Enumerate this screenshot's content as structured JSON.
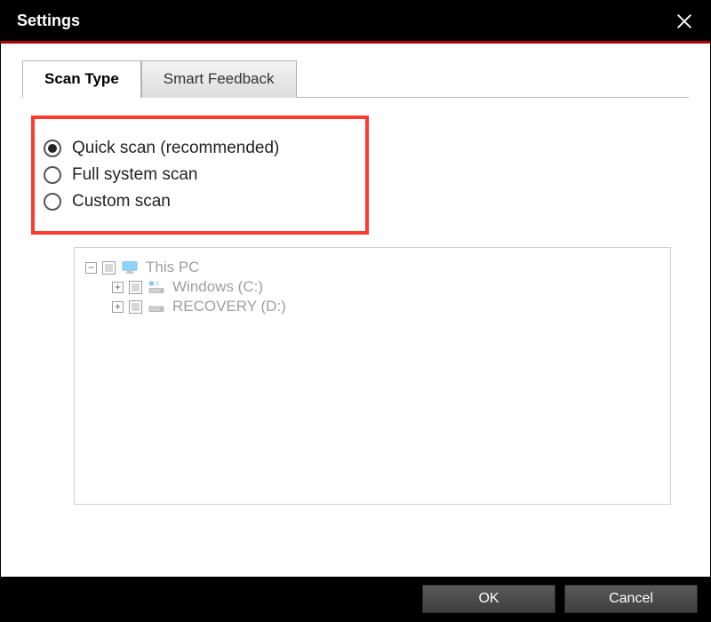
{
  "title": "Settings",
  "tabs": {
    "scan_type": "Scan Type",
    "smart_feedback": "Smart Feedback",
    "active": "scan_type"
  },
  "scan_options": {
    "quick": {
      "label": "Quick scan (recommended)",
      "selected": true
    },
    "full": {
      "label": "Full system scan",
      "selected": false
    },
    "custom": {
      "label": "Custom scan",
      "selected": false
    }
  },
  "tree": {
    "root": {
      "label": "This PC",
      "expanded": true
    },
    "children": [
      {
        "label": "Windows (C:)",
        "expanded": false
      },
      {
        "label": "RECOVERY (D:)",
        "expanded": false
      }
    ]
  },
  "buttons": {
    "ok": "OK",
    "cancel": "Cancel"
  },
  "highlight_color": "#ff3b30",
  "accent_color": "#b00000"
}
